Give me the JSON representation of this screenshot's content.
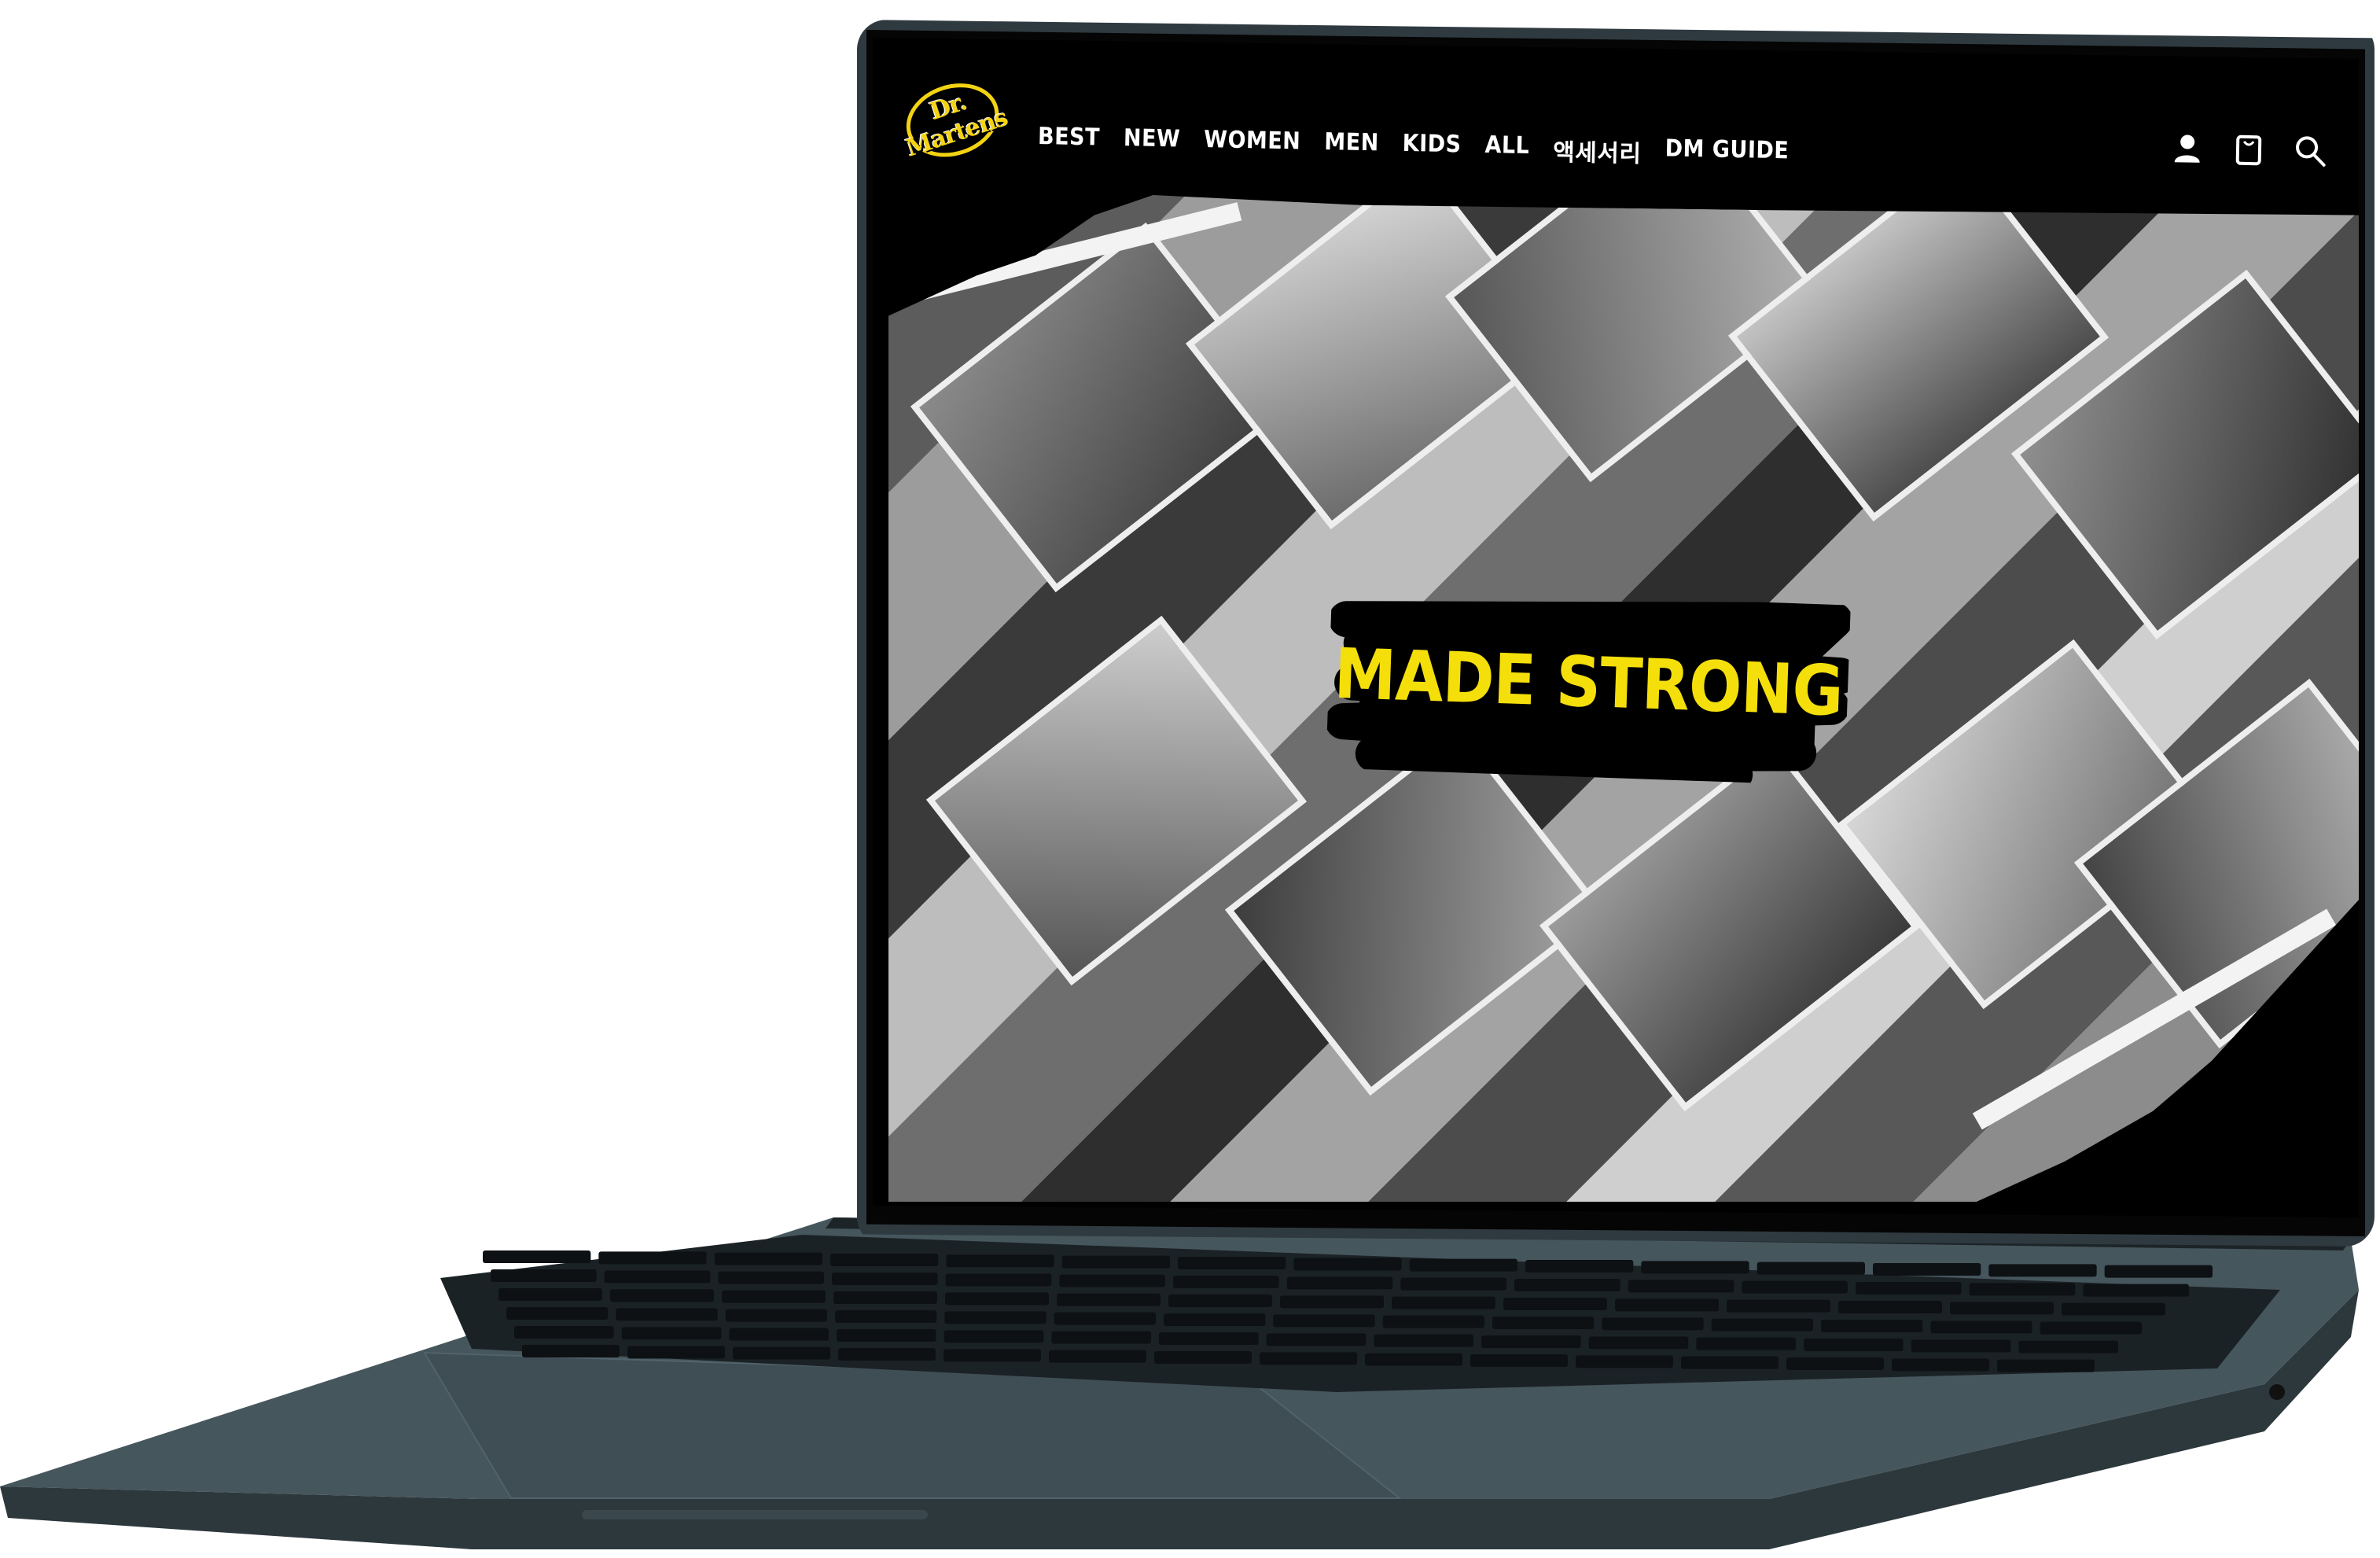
{
  "site": {
    "brand_logo_text": "Dr. Martens",
    "nav": [
      {
        "label": "BEST"
      },
      {
        "label": "NEW"
      },
      {
        "label": "WOMEN"
      },
      {
        "label": "MEN"
      },
      {
        "label": "KIDS"
      },
      {
        "label": "ALL"
      },
      {
        "label": "액세서리"
      },
      {
        "label": "DM GUIDE"
      }
    ],
    "icons": [
      "account-icon",
      "bag-icon",
      "search-icon"
    ],
    "hero": {
      "headline": "MADE STRONG"
    }
  },
  "colors": {
    "accent_yellow": "#f4df0b",
    "laptop_body": "#2f3a40",
    "screen_bg": "#000000"
  }
}
